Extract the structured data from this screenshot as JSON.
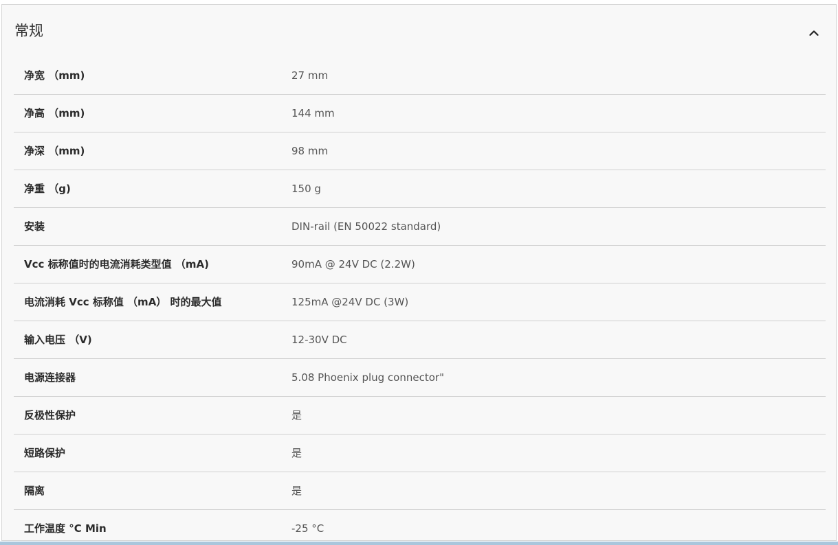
{
  "section": {
    "title": "常规",
    "toggle_icon": "chevron-up-icon"
  },
  "specs": [
    {
      "label": "净宽 （mm)",
      "value": "27 mm"
    },
    {
      "label": "净高 （mm)",
      "value": "144 mm"
    },
    {
      "label": "净深 （mm)",
      "value": "98 mm"
    },
    {
      "label": "净重 （g)",
      "value": "150 g"
    },
    {
      "label": "安装",
      "value": "DIN-rail (EN 50022 standard)"
    },
    {
      "label": "Vcc 标称值时的电流消耗类型值 （mA)",
      "value": "90mA @ 24V DC (2.2W)"
    },
    {
      "label": "电流消耗 Vcc 标称值 （mA） 时的最大值",
      "value": "125mA @24V DC (3W)"
    },
    {
      "label": "输入电压 （V)",
      "value": "12-30V DC"
    },
    {
      "label": "电源连接器",
      "value": "5.08 Phoenix plug connector\""
    },
    {
      "label": "反极性保护",
      "value": "是"
    },
    {
      "label": "短路保护",
      "value": "是"
    },
    {
      "label": "隔离",
      "value": "是"
    },
    {
      "label": "工作温度 °C Min",
      "value": "-25 °C"
    }
  ]
}
